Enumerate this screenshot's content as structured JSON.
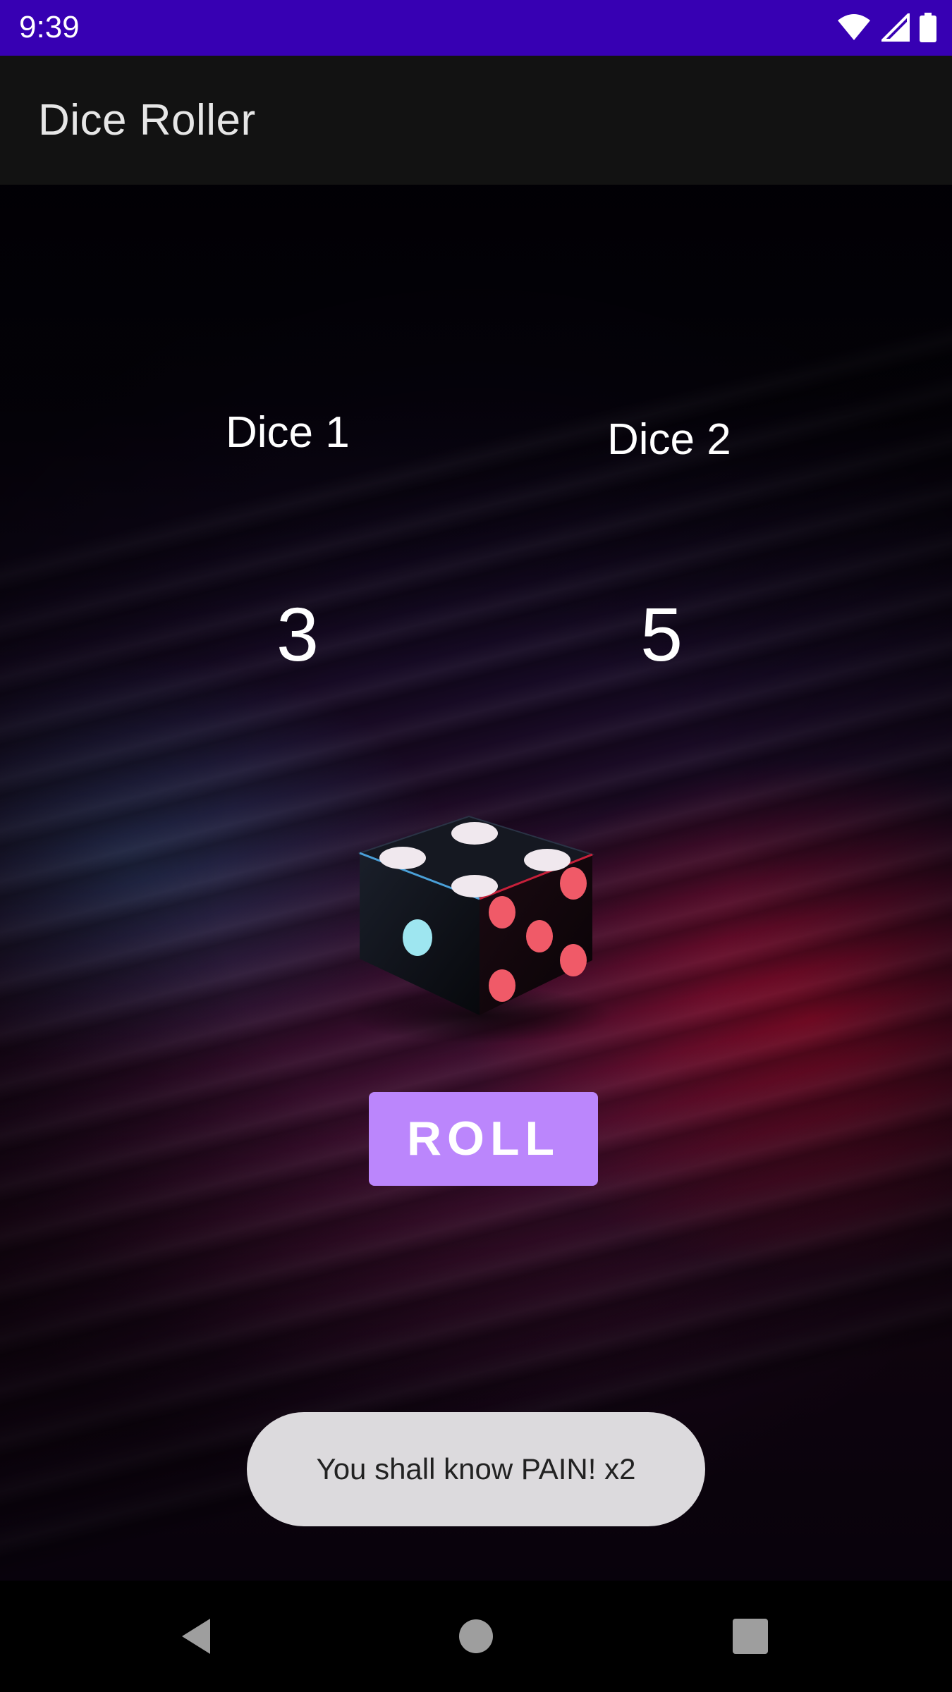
{
  "status_bar": {
    "time": "9:39",
    "icons": [
      "wifi-icon",
      "cellular-signal-icon",
      "battery-icon"
    ],
    "color": "#3700b3"
  },
  "app_bar": {
    "title": "Dice Roller"
  },
  "main": {
    "dice": [
      {
        "label": "Dice 1",
        "value": "3"
      },
      {
        "label": "Dice 2",
        "value": "5"
      }
    ],
    "roll_button": {
      "label": "ROLL",
      "color": "#bb86fc"
    },
    "toast": {
      "message": "You shall know PAIN! x2"
    }
  },
  "nav_bar": {
    "buttons": [
      "back-icon",
      "home-icon",
      "recents-icon"
    ]
  }
}
